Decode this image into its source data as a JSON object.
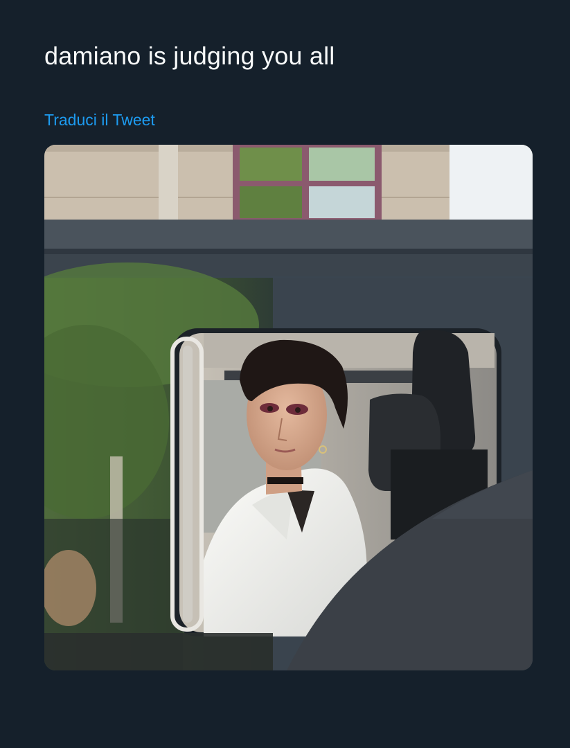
{
  "tweet": {
    "text": "damiano is judging you all",
    "translate_label": "Traduci il Tweet"
  },
  "media": {
    "alt": "Photo of a young man with dark eye makeup and a white jacket looking out of the window of a dark van",
    "colors": {
      "background": "#15202b",
      "text": "#f7f9f9",
      "link": "#1d9bf0"
    }
  }
}
